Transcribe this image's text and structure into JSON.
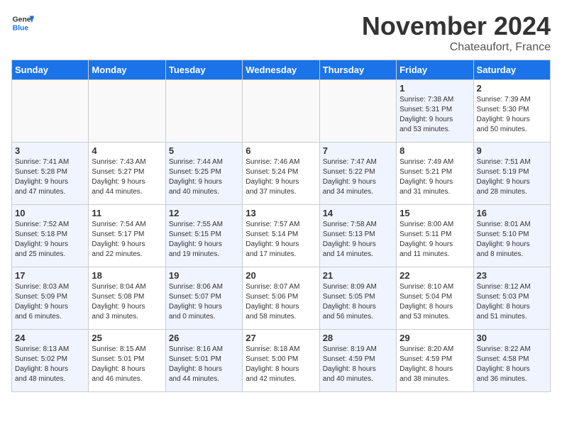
{
  "header": {
    "logo_line1": "General",
    "logo_line2": "Blue",
    "month_title": "November 2024",
    "location": "Chateaufort, France"
  },
  "weekdays": [
    "Sunday",
    "Monday",
    "Tuesday",
    "Wednesday",
    "Thursday",
    "Friday",
    "Saturday"
  ],
  "weeks": [
    [
      {
        "day": "",
        "info": "",
        "empty": true
      },
      {
        "day": "",
        "info": "",
        "empty": true
      },
      {
        "day": "",
        "info": "",
        "empty": true
      },
      {
        "day": "",
        "info": "",
        "empty": true
      },
      {
        "day": "",
        "info": "",
        "empty": true
      },
      {
        "day": "1",
        "info": "Sunrise: 7:38 AM\nSunset: 5:31 PM\nDaylight: 9 hours\nand 53 minutes.",
        "shaded": true
      },
      {
        "day": "2",
        "info": "Sunrise: 7:39 AM\nSunset: 5:30 PM\nDaylight: 9 hours\nand 50 minutes."
      }
    ],
    [
      {
        "day": "3",
        "info": "Sunrise: 7:41 AM\nSunset: 5:28 PM\nDaylight: 9 hours\nand 47 minutes.",
        "shaded": true
      },
      {
        "day": "4",
        "info": "Sunrise: 7:43 AM\nSunset: 5:27 PM\nDaylight: 9 hours\nand 44 minutes."
      },
      {
        "day": "5",
        "info": "Sunrise: 7:44 AM\nSunset: 5:25 PM\nDaylight: 9 hours\nand 40 minutes.",
        "shaded": true
      },
      {
        "day": "6",
        "info": "Sunrise: 7:46 AM\nSunset: 5:24 PM\nDaylight: 9 hours\nand 37 minutes."
      },
      {
        "day": "7",
        "info": "Sunrise: 7:47 AM\nSunset: 5:22 PM\nDaylight: 9 hours\nand 34 minutes.",
        "shaded": true
      },
      {
        "day": "8",
        "info": "Sunrise: 7:49 AM\nSunset: 5:21 PM\nDaylight: 9 hours\nand 31 minutes."
      },
      {
        "day": "9",
        "info": "Sunrise: 7:51 AM\nSunset: 5:19 PM\nDaylight: 9 hours\nand 28 minutes.",
        "shaded": true
      }
    ],
    [
      {
        "day": "10",
        "info": "Sunrise: 7:52 AM\nSunset: 5:18 PM\nDaylight: 9 hours\nand 25 minutes.",
        "shaded": true
      },
      {
        "day": "11",
        "info": "Sunrise: 7:54 AM\nSunset: 5:17 PM\nDaylight: 9 hours\nand 22 minutes."
      },
      {
        "day": "12",
        "info": "Sunrise: 7:55 AM\nSunset: 5:15 PM\nDaylight: 9 hours\nand 19 minutes.",
        "shaded": true
      },
      {
        "day": "13",
        "info": "Sunrise: 7:57 AM\nSunset: 5:14 PM\nDaylight: 9 hours\nand 17 minutes."
      },
      {
        "day": "14",
        "info": "Sunrise: 7:58 AM\nSunset: 5:13 PM\nDaylight: 9 hours\nand 14 minutes.",
        "shaded": true
      },
      {
        "day": "15",
        "info": "Sunrise: 8:00 AM\nSunset: 5:11 PM\nDaylight: 9 hours\nand 11 minutes."
      },
      {
        "day": "16",
        "info": "Sunrise: 8:01 AM\nSunset: 5:10 PM\nDaylight: 9 hours\nand 8 minutes.",
        "shaded": true
      }
    ],
    [
      {
        "day": "17",
        "info": "Sunrise: 8:03 AM\nSunset: 5:09 PM\nDaylight: 9 hours\nand 6 minutes.",
        "shaded": true
      },
      {
        "day": "18",
        "info": "Sunrise: 8:04 AM\nSunset: 5:08 PM\nDaylight: 9 hours\nand 3 minutes."
      },
      {
        "day": "19",
        "info": "Sunrise: 8:06 AM\nSunset: 5:07 PM\nDaylight: 9 hours\nand 0 minutes.",
        "shaded": true
      },
      {
        "day": "20",
        "info": "Sunrise: 8:07 AM\nSunset: 5:06 PM\nDaylight: 8 hours\nand 58 minutes."
      },
      {
        "day": "21",
        "info": "Sunrise: 8:09 AM\nSunset: 5:05 PM\nDaylight: 8 hours\nand 56 minutes.",
        "shaded": true
      },
      {
        "day": "22",
        "info": "Sunrise: 8:10 AM\nSunset: 5:04 PM\nDaylight: 8 hours\nand 53 minutes."
      },
      {
        "day": "23",
        "info": "Sunrise: 8:12 AM\nSunset: 5:03 PM\nDaylight: 8 hours\nand 51 minutes.",
        "shaded": true
      }
    ],
    [
      {
        "day": "24",
        "info": "Sunrise: 8:13 AM\nSunset: 5:02 PM\nDaylight: 8 hours\nand 48 minutes.",
        "shaded": true
      },
      {
        "day": "25",
        "info": "Sunrise: 8:15 AM\nSunset: 5:01 PM\nDaylight: 8 hours\nand 46 minutes."
      },
      {
        "day": "26",
        "info": "Sunrise: 8:16 AM\nSunset: 5:01 PM\nDaylight: 8 hours\nand 44 minutes.",
        "shaded": true
      },
      {
        "day": "27",
        "info": "Sunrise: 8:18 AM\nSunset: 5:00 PM\nDaylight: 8 hours\nand 42 minutes."
      },
      {
        "day": "28",
        "info": "Sunrise: 8:19 AM\nSunset: 4:59 PM\nDaylight: 8 hours\nand 40 minutes.",
        "shaded": true
      },
      {
        "day": "29",
        "info": "Sunrise: 8:20 AM\nSunset: 4:59 PM\nDaylight: 8 hours\nand 38 minutes."
      },
      {
        "day": "30",
        "info": "Sunrise: 8:22 AM\nSunset: 4:58 PM\nDaylight: 8 hours\nand 36 minutes.",
        "shaded": true
      }
    ]
  ]
}
